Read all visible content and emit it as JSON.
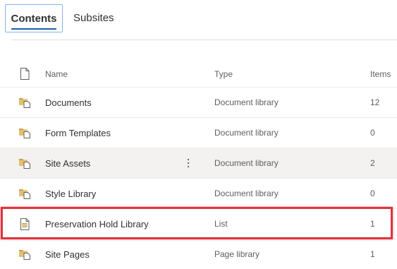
{
  "tabs": {
    "contents_label": "Contents",
    "subsites_label": "Subsites"
  },
  "table": {
    "headers": {
      "name": "Name",
      "type": "Type",
      "items": "Items"
    },
    "rows": [
      {
        "name": "Documents",
        "type": "Document library",
        "items": "12",
        "icon": "folder-library-icon"
      },
      {
        "name": "Form Templates",
        "type": "Document library",
        "items": "0",
        "icon": "folder-library-icon"
      },
      {
        "name": "Site Assets",
        "type": "Document library",
        "items": "2",
        "icon": "folder-library-icon"
      },
      {
        "name": "Style Library",
        "type": "Document library",
        "items": "0",
        "icon": "folder-library-icon"
      },
      {
        "name": "Preservation Hold Library",
        "type": "List",
        "items": "1",
        "icon": "list-document-icon"
      },
      {
        "name": "Site Pages",
        "type": "Page library",
        "items": "1",
        "icon": "folder-library-icon"
      }
    ]
  },
  "colors": {
    "accent": "#1c5fa8",
    "highlight": "#e0343f",
    "folder": "#c8a04a"
  }
}
